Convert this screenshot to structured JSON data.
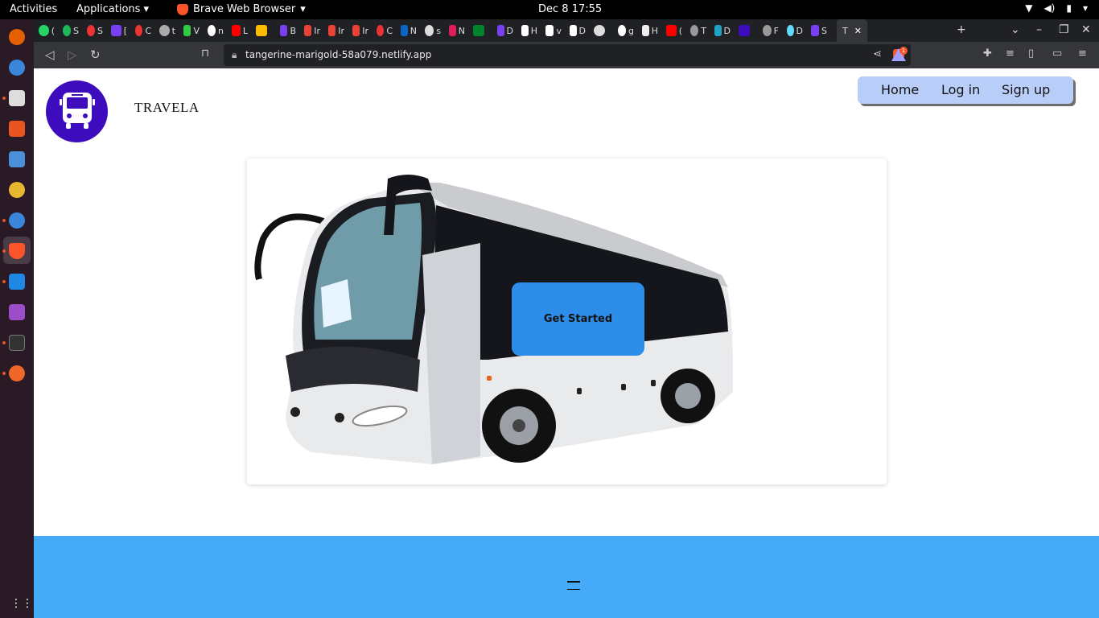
{
  "os": {
    "activities": "Activities",
    "applications": "Applications",
    "browser_menu": "Brave Web Browser",
    "clock": "Dec 8  17:55"
  },
  "browser": {
    "url": "tangerine-marigold-58a079.netlify.app",
    "active_tab_label": "T",
    "tab_favicons": [
      "whatsapp",
      "spotify",
      "red",
      "purple",
      "red",
      "circle",
      "green",
      "google",
      "youtube",
      "drive",
      "purple",
      "gmail",
      "gmail",
      "gmail",
      "red",
      "linkedin",
      "github",
      "slack",
      "meet",
      "purple",
      "triangle",
      "triangle",
      "triangle",
      "github",
      "google",
      "medium",
      "youtube",
      "globe",
      "diamond",
      "travela",
      "globe",
      "react",
      "purple"
    ],
    "tab_letters": [
      "(",
      "S",
      "S",
      "[",
      "C",
      "t",
      "V",
      "n",
      "L",
      "",
      "B",
      "Ir",
      "Ir",
      "Ir",
      "C",
      "N",
      "s",
      "N",
      "",
      "D",
      "H",
      "v",
      "D",
      "",
      "g",
      "H",
      "(",
      "T",
      "D",
      "",
      "F",
      "D",
      "S"
    ],
    "new_tab": "+",
    "rewards_badge": "1"
  },
  "page": {
    "brand": "TRAVELA",
    "nav": {
      "home": "Home",
      "login": "Log in",
      "signup": "Sign up"
    },
    "hero_button": "Get Started"
  },
  "colors": {
    "logo_bg": "#3d0dbd",
    "nav_bg": "#b8cdf8",
    "cta_bg": "#2d8de8",
    "footer_bg": "#45aaf8"
  }
}
